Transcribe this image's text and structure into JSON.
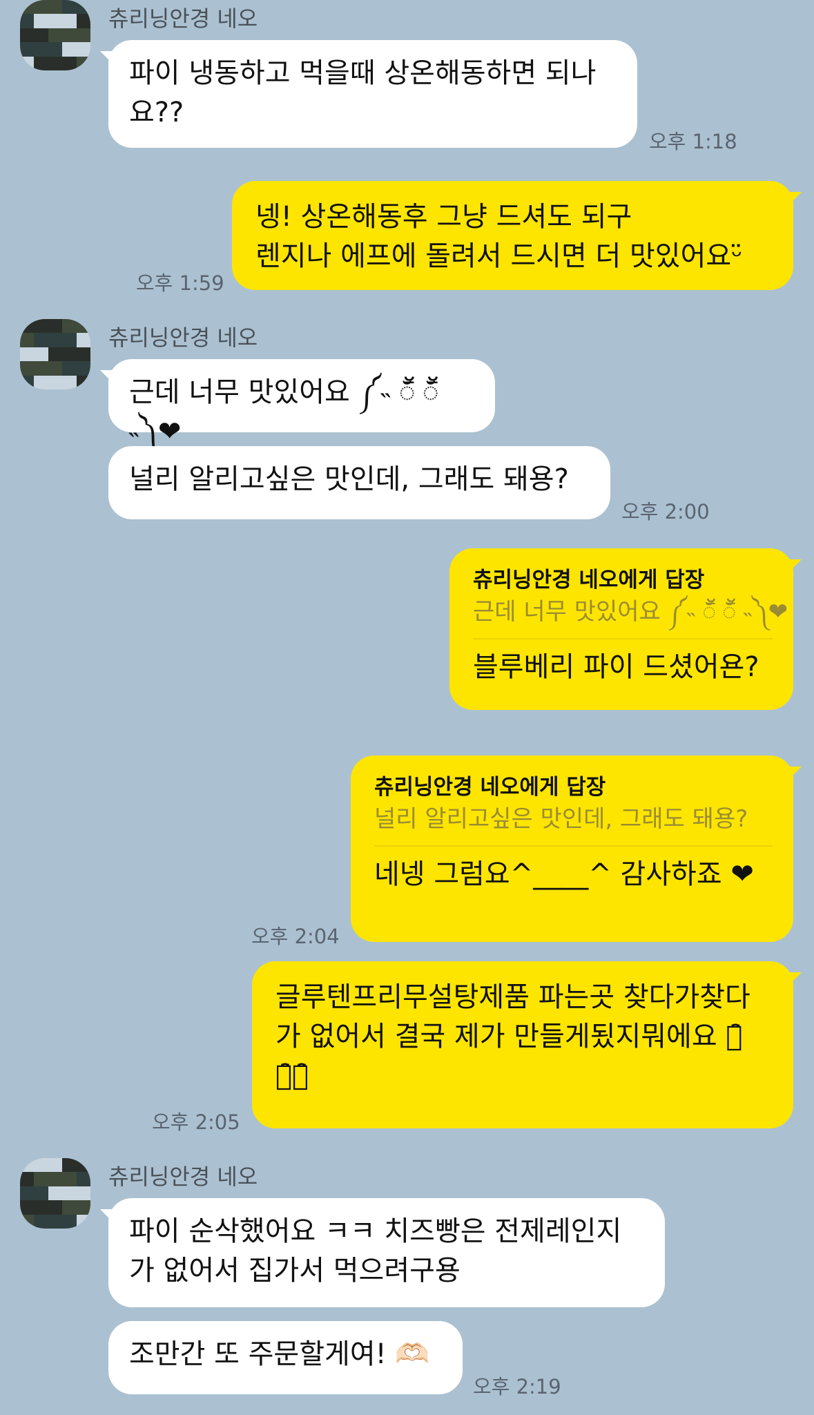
{
  "sender_name": "츄리닝안경 네오",
  "messages": {
    "m1": {
      "text": "파이 냉동하고 먹을때 상온해동하면 되나\n요??",
      "time": "오후 1:18"
    },
    "m2": {
      "text": "넹! 상온해동후 그냥 드셔도 되구\n렌지나 에프에 돌려서 드시면 더 맛있어요ᵕ̈",
      "time": "오후 1:59"
    },
    "m3": {
      "text": "근데 너무 맛있어요 ༼˵ ॕ̆ ॕ̆ ˵༽❤"
    },
    "m4": {
      "text": "널리 알리고싶은 맛인데, 그래도 돼용?",
      "time": "오후 2:00"
    },
    "m5": {
      "reply_to": "츄리닝안경 네오에게 답장",
      "quote": "근데 너무 맛있어요 ༼˵ ॕ̆ ॕ̆ ˵༽❤",
      "text": "블루베리 파이 드셨어욘?"
    },
    "m6": {
      "reply_to": "츄리닝안경 네오에게 답장",
      "quote": "널리 알리고싶은 맛인데, 그래도 돼용?",
      "text": "네넹 그럼요^____^ 감사하죠 ❤",
      "time": "오후 2:04"
    },
    "m7": {
      "text": "글루텐프리무설탕제품 파는곳 찾다가찾다\n가 없어서 결국 제가 만들게됬지뭐에요 ㅋ̑̈\nㅋ̑̈ㅋ̑̈",
      "time": "오후 2:05"
    },
    "m8": {
      "text": "파이 순삭했어요 ㅋㅋ 치즈빵은 전제레인지\n가 없어서 집가서 먹으려구용"
    },
    "m9": {
      "text": "조만간 또 주문할게여! 🫶🏻",
      "time": "오후 2:19"
    }
  },
  "colors": {
    "background": "#abc1d1",
    "my_bubble": "#fee500",
    "their_bubble": "#ffffff"
  }
}
